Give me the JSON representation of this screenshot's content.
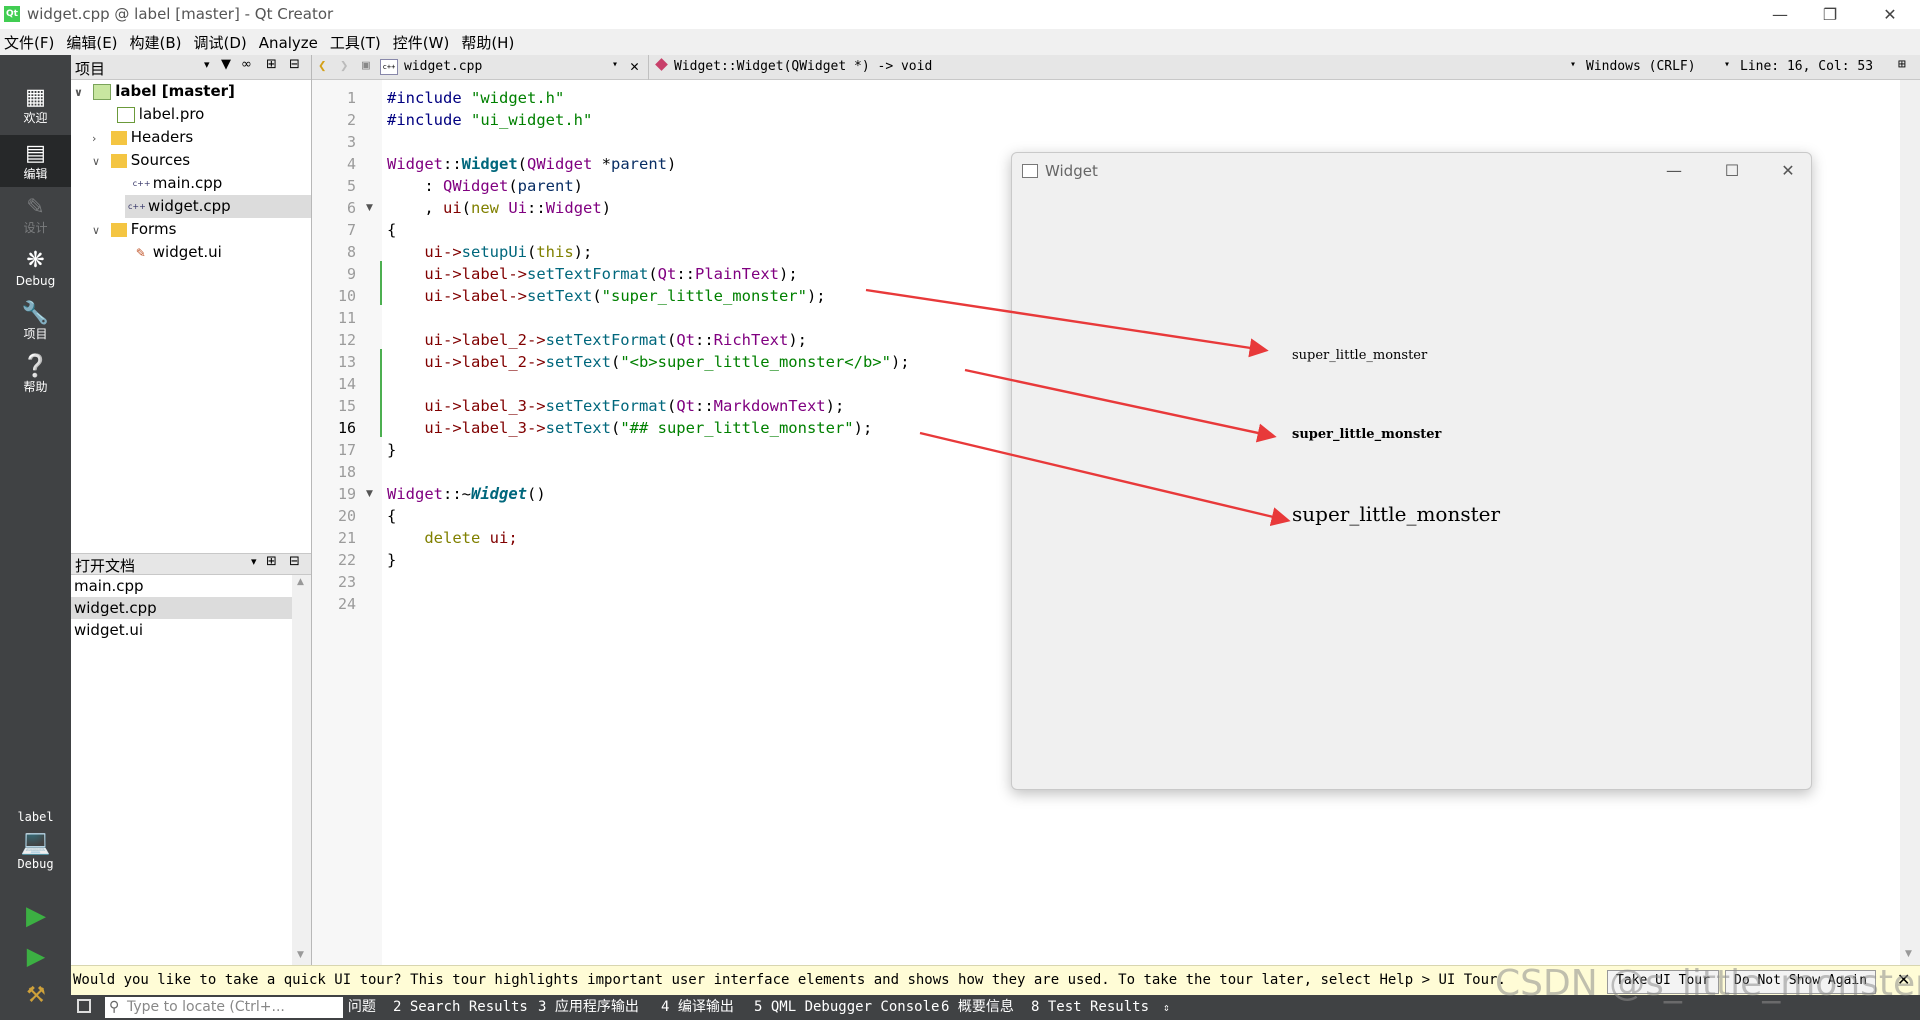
{
  "window": {
    "title": "widget.cpp @ label [master] - Qt Creator"
  },
  "menu": [
    "文件(F)",
    "编辑(E)",
    "构建(B)",
    "调试(D)",
    "Analyze",
    "工具(T)",
    "控件(W)",
    "帮助(H)"
  ],
  "modes": [
    {
      "label": "欢迎",
      "icon": "grid-icon"
    },
    {
      "label": "编辑",
      "icon": "document-icon"
    },
    {
      "label": "设计",
      "icon": "pencil-icon"
    },
    {
      "label": "Debug",
      "icon": "bug-icon"
    },
    {
      "label": "项目",
      "icon": "wrench-icon"
    },
    {
      "label": "帮助",
      "icon": "help-icon"
    }
  ],
  "kit": {
    "project": "label",
    "mode": "Debug"
  },
  "project_panel": {
    "title": "项目",
    "tree": [
      {
        "label": "label [master]"
      },
      {
        "label": "label.pro"
      },
      {
        "label": "Headers"
      },
      {
        "label": "Sources"
      },
      {
        "label": "main.cpp"
      },
      {
        "label": "widget.cpp"
      },
      {
        "label": "Forms"
      },
      {
        "label": "widget.ui"
      }
    ]
  },
  "open_docs": {
    "title": "打开文档",
    "items": [
      "main.cpp",
      "widget.cpp",
      "widget.ui"
    ]
  },
  "editor": {
    "file": "widget.cpp",
    "symbol": "Widget::Widget(QWidget *) -> void",
    "line_ending": "Windows (CRLF)",
    "position": "Line: 16, Col: 53",
    "line_numbers": [
      "1",
      "2",
      "3",
      "4",
      "5",
      "6",
      "7",
      "8",
      "9",
      "10",
      "11",
      "12",
      "13",
      "14",
      "15",
      "16",
      "17",
      "18",
      "19",
      "20",
      "21",
      "22",
      "23",
      "24"
    ]
  },
  "code": {
    "l1a": "#include ",
    "l1b": "\"widget.h\"",
    "l2a": "#include ",
    "l2b": "\"ui_widget.h\"",
    "l4a": "Widget",
    "l4b": "::",
    "l4c": "Widget",
    "l4d": "(",
    "l4e": "QWidget",
    "l4f": " *",
    "l4g": "parent",
    "l4h": ")",
    "l5a": "    : ",
    "l5b": "QWidget",
    "l5c": "(",
    "l5d": "parent",
    "l5e": ")",
    "l6a": "    , ",
    "l6b": "ui",
    "l6c": "(",
    "l6d": "new",
    "l6e": " ",
    "l6f": "Ui",
    "l6g": "::",
    "l6h": "Widget",
    "l6i": ")",
    "l7": "{",
    "l8a": "    ui->",
    "l8b": "setupUi",
    "l8c": "(",
    "l8d": "this",
    "l8e": ");",
    "l9a": "    ui->label->",
    "l9b": "setTextFormat",
    "l9c": "(",
    "l9d": "Qt",
    "l9e": "::",
    "l9f": "PlainText",
    "l9g": ");",
    "l10a": "    ui->label->",
    "l10b": "setText",
    "l10c": "(",
    "l10d": "\"super_little_monster\"",
    "l10e": ");",
    "l12a": "    ui->label_2->",
    "l12b": "setTextFormat",
    "l12c": "(",
    "l12d": "Qt",
    "l12e": "::",
    "l12f": "RichText",
    "l12g": ");",
    "l13a": "    ui->label_2->",
    "l13b": "setText",
    "l13c": "(",
    "l13d": "\"<b>super_little_monster</b>\"",
    "l13e": ");",
    "l15a": "    ui->label_3->",
    "l15b": "setTextFormat",
    "l15c": "(",
    "l15d": "Qt",
    "l15e": "::",
    "l15f": "MarkdownText",
    "l15g": ");",
    "l16a": "    ui->label_3->",
    "l16b": "setText",
    "l16c": "(",
    "l16d": "\"## super_little_monster\"",
    "l16e": ");",
    "l17": "}",
    "l19a": "Widget",
    "l19b": "::~",
    "l19c": "Widget",
    "l19d": "()",
    "l20": "{",
    "l21a": "    ",
    "l21b": "delete",
    "l21c": " ui;",
    "l22": "}"
  },
  "widget_window": {
    "title": "Widget",
    "labels": [
      "super_little_monster",
      "super_little_monster",
      "super_little_monster"
    ]
  },
  "tour": {
    "message": "Would you like to take a quick UI tour? This tour highlights important user interface elements and shows how they are used. To take the tour later, select Help > UI Tour.",
    "take": "Take UI Tour",
    "dismiss": "Do Not Show Again"
  },
  "status": {
    "locate_placeholder": "Type to locate (Ctrl+...",
    "tabs": [
      "1 问题",
      "2 Search Results",
      "3 应用程序输出",
      "4 编译输出",
      "5 QML Debugger Console",
      "6 概要信息",
      "8 Test Results"
    ]
  },
  "watermark": "CSDN @s_little_monster",
  "colors": {
    "arrow": "#e8393a",
    "accent_green": "#41cd52",
    "mode_bar": "#404244"
  }
}
